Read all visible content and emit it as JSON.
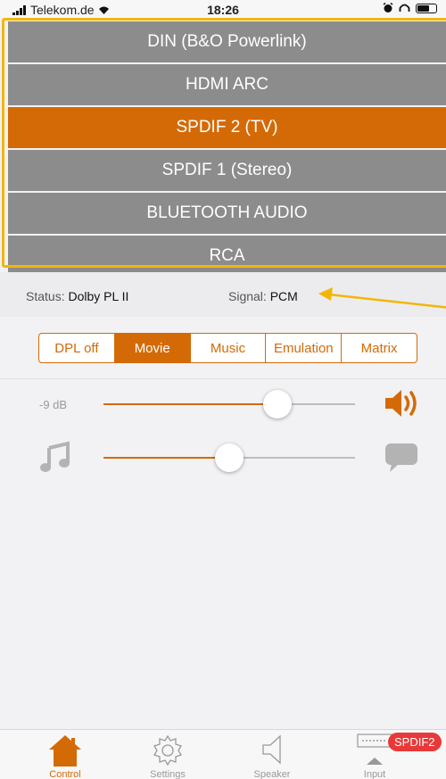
{
  "status_bar": {
    "carrier": "Telekom.de",
    "time": "18:26"
  },
  "inputs": [
    {
      "label": "DIN (B&O Powerlink)",
      "active": false
    },
    {
      "label": "HDMI ARC",
      "active": false
    },
    {
      "label": "SPDIF 2 (TV)",
      "active": true
    },
    {
      "label": "SPDIF 1 (Stereo)",
      "active": false
    },
    {
      "label": "BLUETOOTH AUDIO",
      "active": false
    },
    {
      "label": "RCA",
      "active": false
    }
  ],
  "status": {
    "status_label": "Status:",
    "status_value": "Dolby PL II",
    "signal_label": "Signal:",
    "signal_value": "PCM"
  },
  "modes": [
    {
      "label": "DPL off",
      "active": false
    },
    {
      "label": "Movie",
      "active": true
    },
    {
      "label": "Music",
      "active": false
    },
    {
      "label": "Emulation",
      "active": false
    },
    {
      "label": "Matrix",
      "active": false
    }
  ],
  "volume": {
    "label": "-9 dB",
    "fraction": 0.69
  },
  "balance": {
    "fraction": 0.5
  },
  "tabs": [
    {
      "label": "Control",
      "icon": "house-icon",
      "active": true
    },
    {
      "label": "Settings",
      "icon": "gear-icon",
      "active": false
    },
    {
      "label": "Speaker",
      "icon": "speaker-icon",
      "active": false
    },
    {
      "label": "Input",
      "icon": "input-icon",
      "active": false
    }
  ],
  "input_badge": "SPDIF2",
  "colors": {
    "accent": "#d46a06",
    "inactive": "#8c8c8c",
    "highlight": "#f2b705",
    "badge": "#e8393a"
  }
}
